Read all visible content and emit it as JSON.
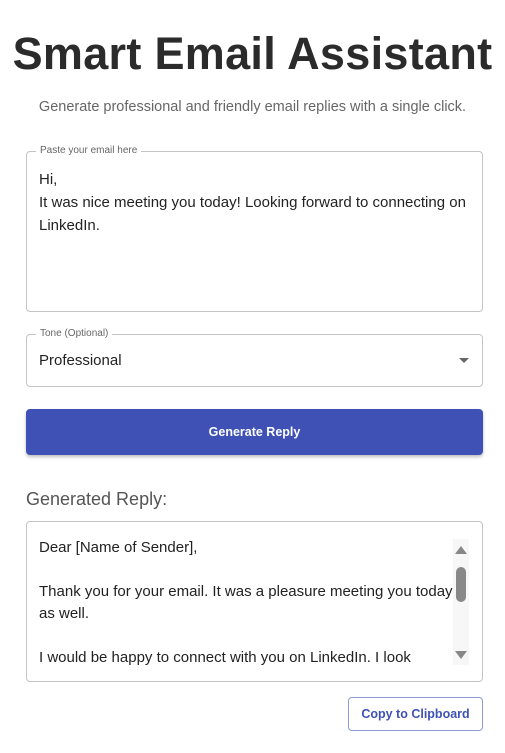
{
  "header": {
    "title": "Smart Email Assistant",
    "subtitle": "Generate professional and friendly email replies with a single click."
  },
  "email": {
    "label": "Paste your email here",
    "value": "Hi,\nIt was nice meeting you today! Looking forward to connecting on LinkedIn."
  },
  "tone": {
    "label": "Tone (Optional)",
    "value": "Professional"
  },
  "generate_label": "Generate Reply",
  "reply": {
    "heading": "Generated Reply:",
    "value": "Dear [Name of Sender],\n\nThank you for your email. It was a pleasure meeting you today as well.\n\nI would be happy to connect with you on LinkedIn. I look",
    "scroll_position": 0.1
  },
  "copy_label": "Copy to Clipboard",
  "colors": {
    "primary": "#3f51b5"
  }
}
